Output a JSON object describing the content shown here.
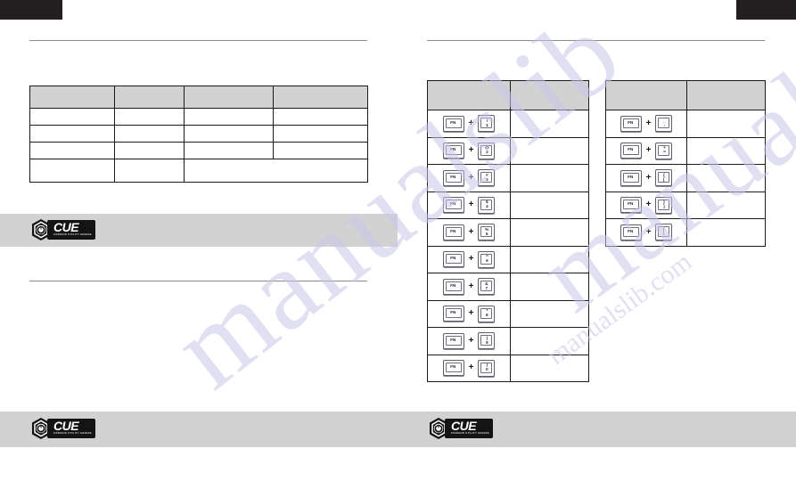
{
  "document": {
    "type": "two-page-manual-spread",
    "page_background": "#ffffff",
    "accent_dark": "#231f20",
    "band_gray": "#d2d2d2",
    "rule_gray": "#8a8a8a",
    "table_header_gray": "#d2d2d2"
  },
  "watermark": {
    "line_a": "manualslib",
    "line_b": "manualslib.com",
    "line_c": "manualslib.com",
    "color": "#c9c6e8"
  },
  "brand": {
    "logo_word": "CUE",
    "logo_subtitle": "CORSAIR UTILITY ENGINE",
    "mark_name": "corsair-sail-hex-icon"
  },
  "left_page": {
    "header_tab_label": "",
    "table": {
      "columns": [
        "",
        "",
        "",
        ""
      ],
      "header_row": [
        "",
        "",
        "",
        ""
      ],
      "rows": [
        [
          "",
          "",
          "",
          ""
        ],
        [
          "",
          "",
          "",
          ""
        ],
        [
          "",
          "",
          "",
          ""
        ],
        [
          "",
          "",
          "",
          ""
        ]
      ],
      "last_row_merged_columns": [
        3,
        4
      ]
    },
    "rules": 2
  },
  "middle_table": {
    "header_row": [
      "",
      ""
    ],
    "rows": [
      {
        "modifier": "FN",
        "key_top": "!",
        "key_bottom": "1",
        "key_style": "stacked",
        "description": ""
      },
      {
        "modifier": "FN",
        "key_top": "@",
        "key_bottom": "2",
        "key_style": "stacked",
        "description": ""
      },
      {
        "modifier": "FN",
        "key_top": "#",
        "key_bottom": "3",
        "key_style": "stacked",
        "description": ""
      },
      {
        "modifier": "FN",
        "key_top": "$",
        "key_bottom": "4",
        "key_style": "stacked",
        "description": ""
      },
      {
        "modifier": "FN",
        "key_top": "%",
        "key_bottom": "5",
        "key_style": "stacked",
        "description": ""
      },
      {
        "modifier": "FN",
        "key_top": "^",
        "key_bottom": "6",
        "key_style": "stacked",
        "description": ""
      },
      {
        "modifier": "FN",
        "key_top": "&",
        "key_bottom": "7",
        "key_style": "stacked",
        "description": ""
      },
      {
        "modifier": "FN",
        "key_top": "*",
        "key_bottom": "8",
        "key_style": "stacked",
        "description": ""
      },
      {
        "modifier": "FN",
        "key_top": "(",
        "key_bottom": "9",
        "key_style": "stacked",
        "description": ""
      },
      {
        "modifier": "FN",
        "key_top": ")",
        "key_bottom": "0",
        "key_style": "stacked",
        "description": ""
      }
    ]
  },
  "right_table": {
    "header_row": [
      "",
      ""
    ],
    "rows": [
      {
        "modifier": "FN",
        "key_top": "_",
        "key_bottom": "-",
        "key_style": "stacked",
        "description": ""
      },
      {
        "modifier": "FN",
        "key_top": "+",
        "key_bottom": "=",
        "key_style": "stacked",
        "description": ""
      },
      {
        "modifier": "FN",
        "key_top": "{",
        "key_bottom": "[",
        "key_style": "stacked",
        "description": ""
      },
      {
        "modifier": "FN",
        "key_top": "}",
        "key_bottom": "]",
        "key_style": "stacked",
        "description": ""
      },
      {
        "modifier": "FN",
        "key_top": "|",
        "key_bottom": "\\",
        "key_style": "stacked",
        "description": ""
      }
    ]
  }
}
